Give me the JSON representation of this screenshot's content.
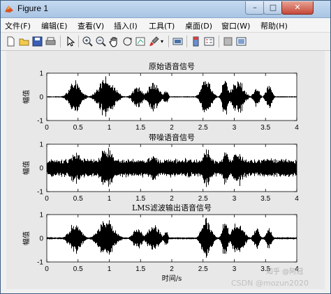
{
  "window": {
    "title": "Figure 1",
    "controls": {
      "minimize": "–",
      "maximize": "□",
      "close": "✕"
    }
  },
  "menubar": [
    "文件(F)",
    "编辑(E)",
    "查看(V)",
    "插入(I)",
    "工具(T)",
    "桌面(D)",
    "窗口(W)",
    "帮助(H)"
  ],
  "toolbar": {
    "icons": [
      "new-figure-icon",
      "open-file-icon",
      "save-icon",
      "print-icon",
      "edit-plot-arrow-icon",
      "zoom-in-icon",
      "zoom-out-icon",
      "pan-hand-icon",
      "rotate-3d-icon",
      "data-cursor-icon",
      "brush-icon",
      "link-plot-icon",
      "colorbar-icon",
      "legend-icon",
      "hide-plot-tools-icon",
      "show-plot-tools-icon"
    ]
  },
  "plots": [
    {
      "title": "原始语音信号",
      "ylabel": "幅值",
      "xlabel": ""
    },
    {
      "title": "带噪语音信号",
      "ylabel": "幅值",
      "xlabel": ""
    },
    {
      "title": "LMS滤波输出语音信号",
      "ylabel": "幅值",
      "xlabel": "时间/s"
    }
  ],
  "axes": {
    "xlim": [
      0,
      4
    ],
    "ylim": [
      -1,
      1
    ],
    "xticks": [
      "0",
      "0.5",
      "1",
      "1.5",
      "2",
      "2.5",
      "3",
      "3.5",
      "4"
    ],
    "yticks": [
      "1",
      "0",
      "-1"
    ]
  },
  "watermarks": {
    "zhihu": "知乎 @阿冠",
    "csdn": "CSDN @mozun2020"
  },
  "colors": {
    "signal": "#000000",
    "titlebar": "#b8d0ec",
    "figure_bg": "#e8e8e8"
  }
}
